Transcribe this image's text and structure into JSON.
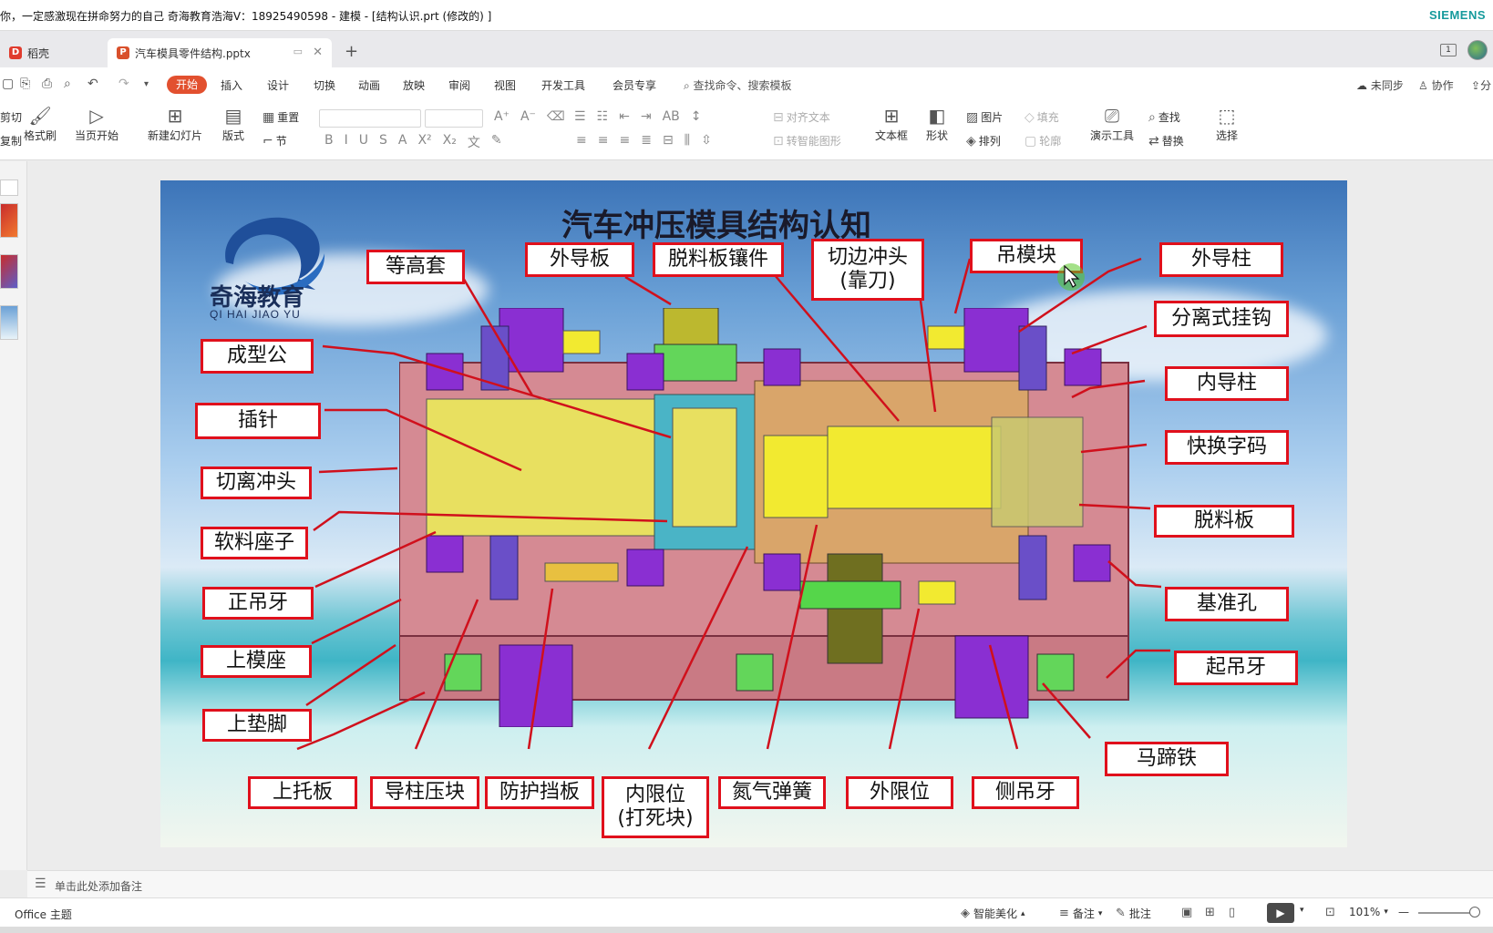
{
  "window": {
    "title": "你，一定感激现在拼命努力的自己  奇海教育浩海V：18925490598 - 建模 - [结构认识.prt  (修改的) ]",
    "brand": "SIEMENS"
  },
  "tabs": {
    "home_label": "稻壳",
    "doc_label": "汽车模具零件结构.pptx",
    "add_label": "+",
    "close_label": "✕"
  },
  "menu": {
    "items": [
      "开始",
      "插入",
      "设计",
      "切换",
      "动画",
      "放映",
      "审阅",
      "视图",
      "开发工具",
      "会员专享"
    ],
    "search_placeholder": "查找命令、搜索模板",
    "sync": "未同步",
    "collab": "协作",
    "share": "分"
  },
  "ribbon": {
    "cut": "剪切",
    "copy": "复制",
    "format_painter": "格式刷",
    "from_current": "当页开始",
    "new_slide": "新建幻灯片",
    "layout": "版式",
    "reset": "重置",
    "section": "节",
    "align_text": "对齐文本",
    "smart_shape": "转智能图形",
    "textbox": "文本框",
    "shape": "形状",
    "picture": "图片",
    "arrange": "排列",
    "fill": "填充",
    "outline": "轮廓",
    "present_tools": "演示工具",
    "find": "查找",
    "replace": "替换",
    "select": "选择"
  },
  "slide": {
    "title": "汽车冲压模具结构认知",
    "logo_text": "奇海教育",
    "logo_sub": "QI HAI JIAO YU",
    "labels": {
      "denggaotao": "等高套",
      "waidaoban": "外导板",
      "tuoliaobanxiangjian": "脱料板镶件",
      "qiebianchongtou": "切边冲头\n(靠刀)",
      "diaomokuai": "吊模块",
      "waidaozhu": "外导柱",
      "fenlishiguagou": "分离式挂钩",
      "chengxinggong": "成型公",
      "neidaozhu": "内导柱",
      "chazhen": "插针",
      "kuaihuanzima": "快换字码",
      "qielichongtou": "切离冲头",
      "tuoliaoban": "脱料板",
      "ruanliaozuozi": "软料座子",
      "zhengdiaoya": "正吊牙",
      "zhunkong": "基准孔",
      "shangmozuo": "上模座",
      "qidiaoya": "起吊牙",
      "shangdianjiao": "上垫脚",
      "matitie": "马蹄铁",
      "shangtuoban": "上托板",
      "daozhuyakuai": "导柱压块",
      "fanghudangban": "防护挡板",
      "neixianwei": "内限位\n(打死块)",
      "danqitanhuang": "氮气弹簧",
      "waixianwei": "外限位",
      "cediaoya": "侧吊牙"
    }
  },
  "notes": {
    "placeholder": "单击此处添加备注"
  },
  "status": {
    "theme": "Office 主题",
    "beautify": "智能美化",
    "notes": "备注",
    "comment": "批注",
    "zoom": "101%"
  },
  "colors": {
    "accent": "#e2502f",
    "label_border": "#e0101c",
    "brand": "#159a9c"
  }
}
